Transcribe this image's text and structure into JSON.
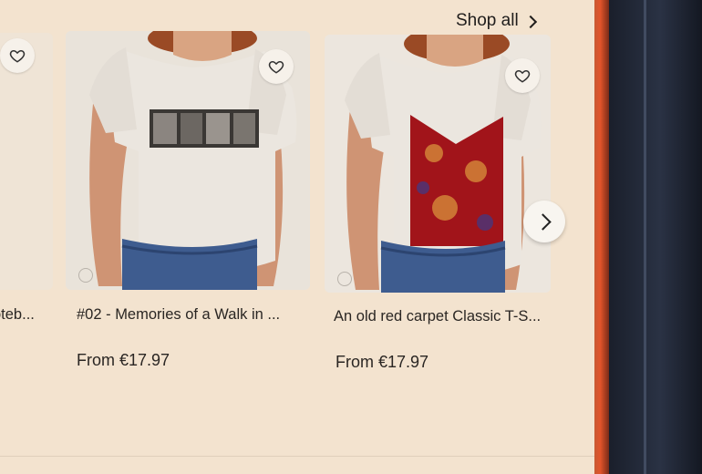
{
  "header": {
    "shop_all_label": "Shop all"
  },
  "products": [
    {
      "title": "...oteb...",
      "title_visible": "oteb..."
    },
    {
      "title": "#02 - Memories of a Walk in ...",
      "price": "From €17.97"
    },
    {
      "title": "An old red carpet Classic T-S...",
      "price": "From €17.97"
    }
  ],
  "colors": {
    "accent_red": "#e2542a",
    "carpet_red": "#a1141a",
    "denim": "#3e5c8f"
  },
  "icons": {
    "favorite": "heart-outline-icon",
    "next": "chevron-right-icon",
    "info": "info-icon"
  }
}
